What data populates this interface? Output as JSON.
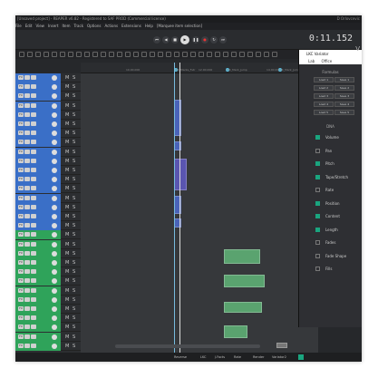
{
  "window": {
    "title": "[Unsaved project] - REAPER v6.82 - Registered to SAF PROD (Commercial license)",
    "author": "D Orlovcevic"
  },
  "menu": [
    "File",
    "Edit",
    "View",
    "Insert",
    "Item",
    "Track",
    "Options",
    "Actions",
    "Extensions",
    "Help",
    "[Marquee item selection]"
  ],
  "transport": {
    "time": "0:11.152",
    "buttons": [
      "go-start",
      "play-back",
      "stop",
      "play",
      "pause",
      "record",
      "loop",
      "go-end"
    ]
  },
  "ruler": {
    "ticks": [
      "10.00.000",
      "12.00.000",
      "14.00.000"
    ],
    "markers": [
      "5PK_Marks_Fstr",
      "5PK_Mark_Jump",
      "5PK_Mark_Jump2"
    ]
  },
  "tracks": {
    "count": 30,
    "labels": [
      "M",
      "S"
    ],
    "fx_label": "FX",
    "colors": {
      "blue": "#3a6fc7",
      "green": "#2fa35a"
    }
  },
  "panel": {
    "title": "LKC Variator",
    "tabs": [
      "Lab",
      "Office"
    ],
    "side_letter": "V",
    "formulas_title": "Formulas",
    "formulas": [
      [
        "Load 1",
        "Save 1"
      ],
      [
        "Load 2",
        "Save 2"
      ],
      [
        "Load 3",
        "Save 3"
      ],
      [
        "Load 4",
        "Save 4"
      ],
      [
        "Load 5",
        "Save 5"
      ]
    ],
    "dna_title": "DNA",
    "dna": [
      {
        "label": "Volume",
        "checked": true
      },
      {
        "label": "Pan",
        "checked": false
      },
      {
        "label": "Pitch",
        "checked": true
      },
      {
        "label": "Tape/Stretch",
        "checked": true
      },
      {
        "label": "Rate",
        "checked": false
      },
      {
        "label": "Position",
        "checked": true
      },
      {
        "label": "Content",
        "checked": true
      },
      {
        "label": "Length",
        "checked": true
      },
      {
        "label": "Fades",
        "checked": false
      },
      {
        "label": "Fade Shape",
        "checked": false
      },
      {
        "label": "Fills",
        "checked": false
      }
    ]
  },
  "bottom": {
    "items": [
      "Reverse",
      "LKC",
      "J.Facts",
      "Rate",
      "Render",
      "Variator2"
    ],
    "accent": "#1aa57f"
  }
}
